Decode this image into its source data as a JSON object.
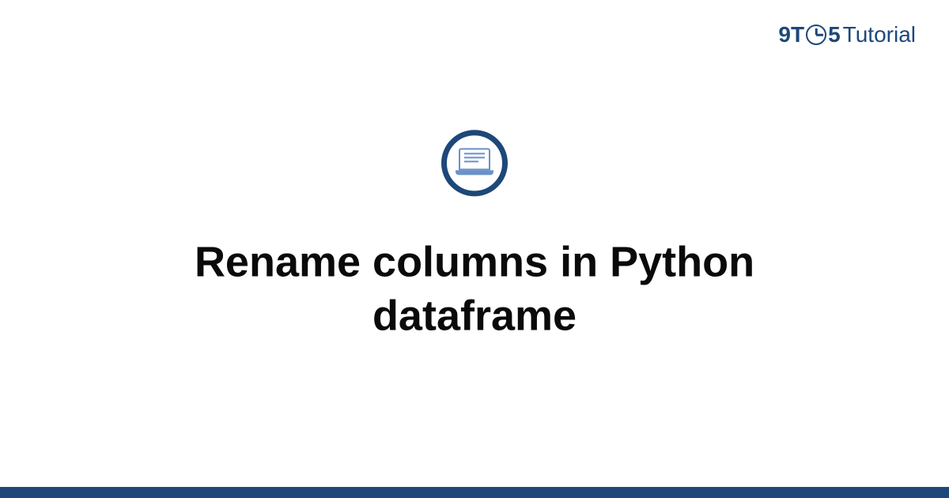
{
  "logo": {
    "part1": "9T",
    "part2": "5",
    "part3": "Tutorial"
  },
  "title": "Rename columns in Python dataframe",
  "colors": {
    "primary": "#1d4879",
    "icon": "#6a91c9"
  }
}
